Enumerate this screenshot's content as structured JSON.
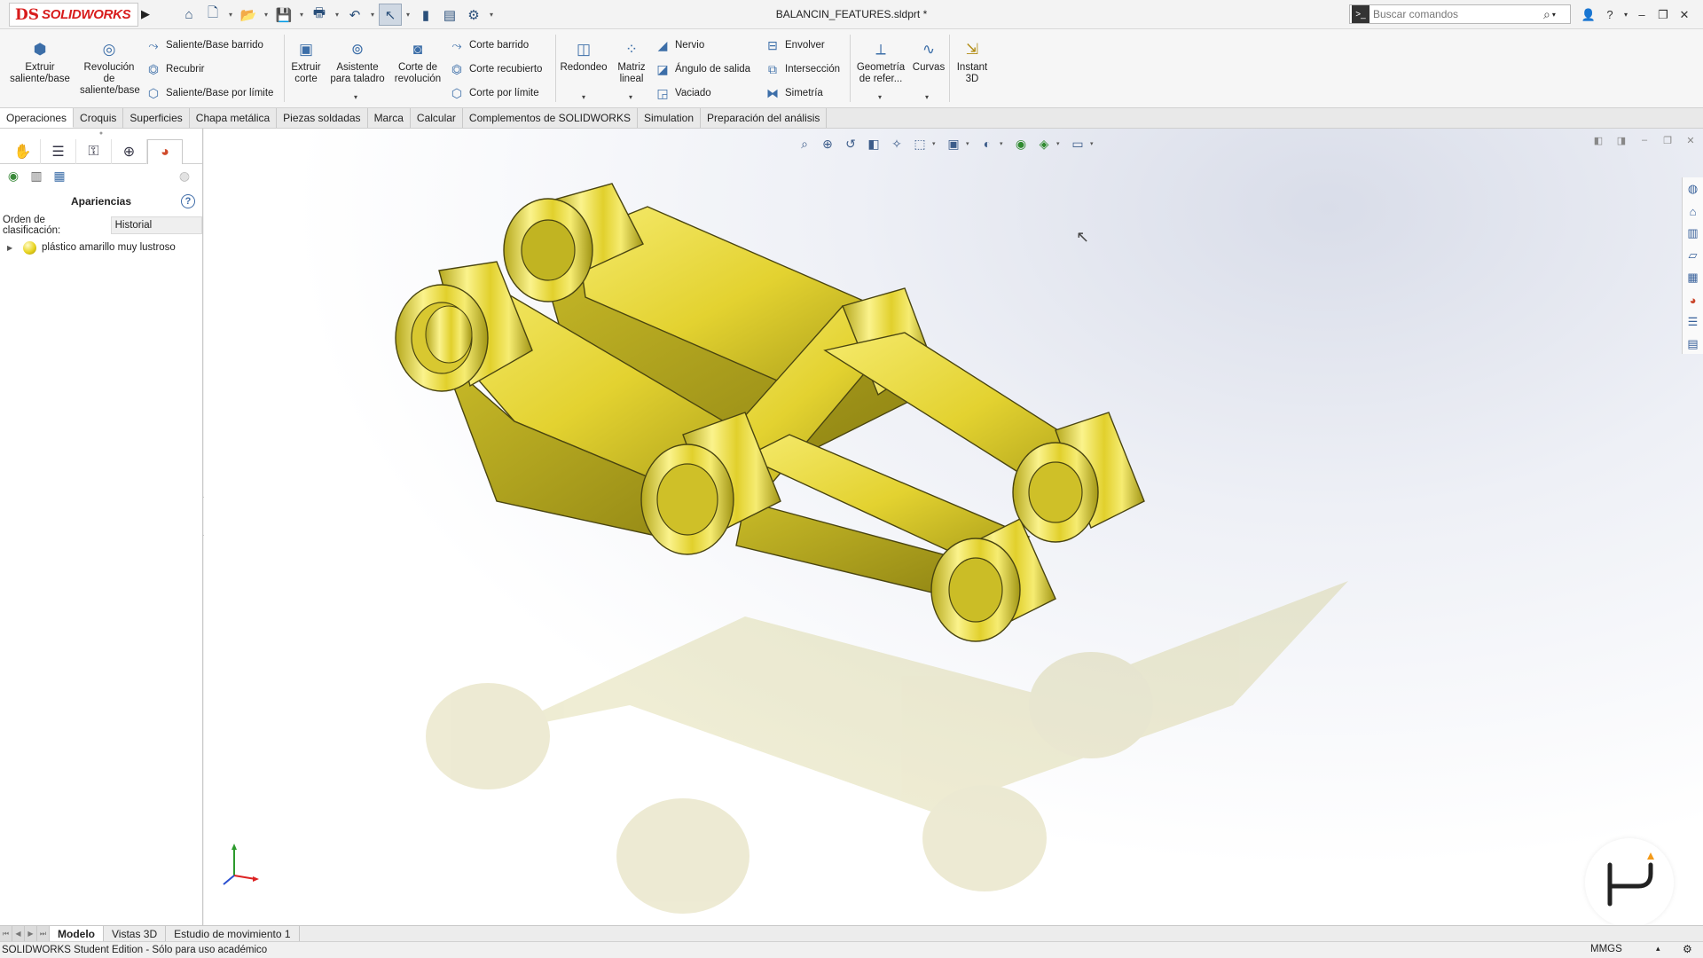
{
  "app": {
    "brand_ds": "DS",
    "brand_name": "SOLIDWORKS",
    "document_title": "BALANCIN_FEATURES.sldprt *",
    "search_placeholder": "Buscar comandos"
  },
  "ribbon": {
    "extrude_boss": "Extruir saliente/base",
    "revolve_boss": "Revolución de saliente/base",
    "swept_boss": "Saliente/Base barrido",
    "loft_boss": "Recubrir",
    "boundary_boss": "Saliente/Base por límite",
    "extrude_cut": "Extruir corte",
    "hole_wizard": "Asistente para taladro",
    "revolve_cut": "Corte de revolución",
    "swept_cut": "Corte barrido",
    "loft_cut": "Corte recubierto",
    "boundary_cut": "Corte por límite",
    "fillet": "Redondeo",
    "linear_pattern": "Matriz lineal",
    "rib": "Nervio",
    "draft": "Ángulo de salida",
    "shell": "Vaciado",
    "wrap": "Envolver",
    "intersect": "Intersección",
    "mirror": "Simetría",
    "ref_geometry": "Geometría de refer...",
    "curves": "Curvas",
    "instant3d": "Instant 3D"
  },
  "tabs": [
    "Operaciones",
    "Croquis",
    "Superficies",
    "Chapa metálica",
    "Piezas soldadas",
    "Marca",
    "Calcular",
    "Complementos de SOLIDWORKS",
    "Simulation",
    "Preparación del análisis"
  ],
  "left_panel": {
    "title": "Apariencias",
    "sort_label": "Orden de clasificación:",
    "sort_value": "Historial",
    "tree_item": "plástico amarillo muy lustroso"
  },
  "bottom_tabs": [
    "Modelo",
    "Vistas 3D",
    "Estudio de movimiento 1"
  ],
  "status": {
    "text": "SOLIDWORKS Student Edition - Sólo para uso académico",
    "units": "MMGS"
  },
  "colors": {
    "brand_red": "#d81c1c",
    "part_yellow": "#e6d42a",
    "accent_blue": "#3c6ea8"
  }
}
